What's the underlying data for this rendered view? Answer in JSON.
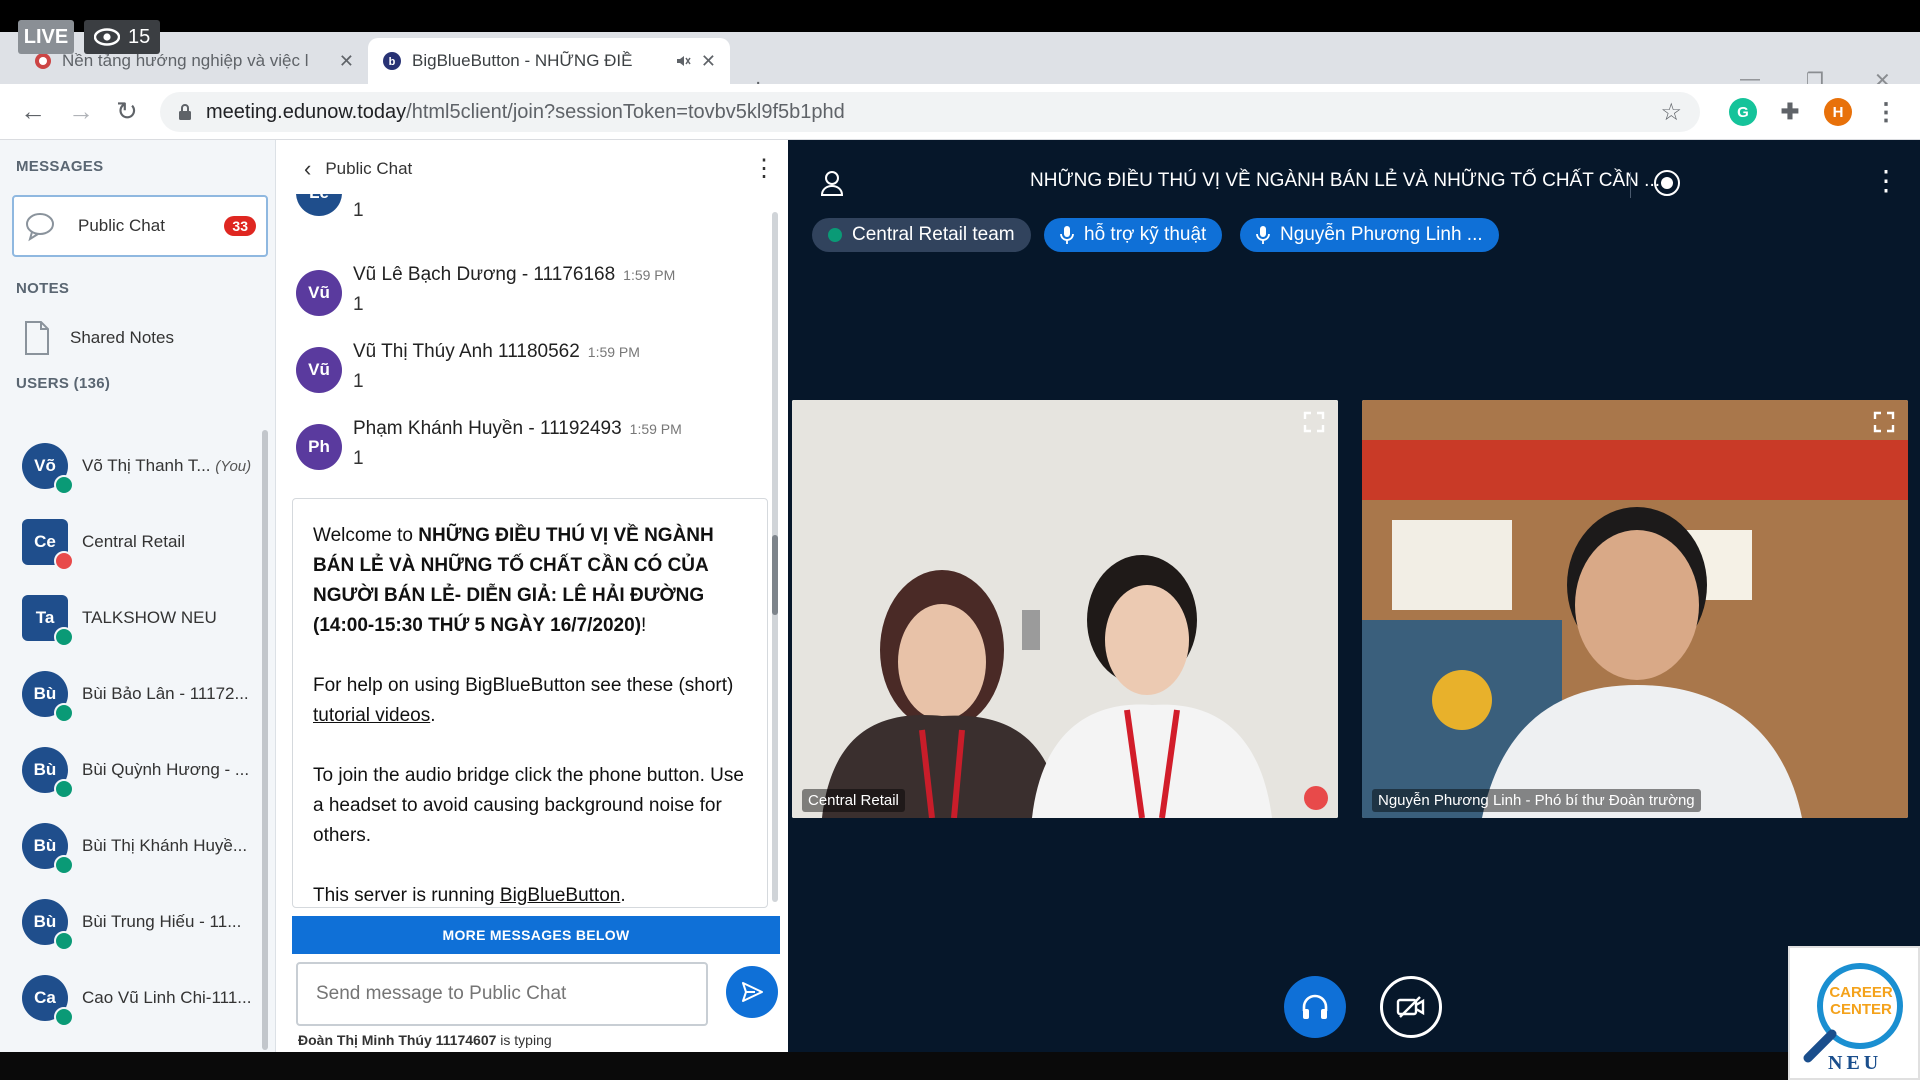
{
  "stream": {
    "live_label": "LIVE",
    "viewer_count": "15"
  },
  "browser": {
    "tabs": [
      {
        "title": "Nền tảng hướng nghiệp và việc l",
        "active": false
      },
      {
        "title": "BigBlueButton - NHỮNG ĐIỀ",
        "active": true
      }
    ],
    "url_host": "meeting.edunow.today",
    "url_path": "/html5client/join?sessionToken=tovbv5kl9f5b1phd",
    "profile_initial": "H"
  },
  "sidebar": {
    "messages_heading": "MESSAGES",
    "public_chat_label": "Public Chat",
    "unread_count": "33",
    "notes_heading": "NOTES",
    "shared_notes_label": "Shared Notes",
    "users_heading": "USERS (136)",
    "users": [
      {
        "initials": "Võ",
        "name": "Võ Thị Thanh T...",
        "you": "(You)",
        "badge": "green",
        "shape": "circle"
      },
      {
        "initials": "Ce",
        "name": "Central Retail",
        "you": "",
        "badge": "red",
        "shape": "square"
      },
      {
        "initials": "Ta",
        "name": "TALKSHOW NEU",
        "you": "",
        "badge": "green",
        "shape": "square"
      },
      {
        "initials": "Bù",
        "name": "Bùi Bảo Lân - 11172...",
        "you": "",
        "badge": "green",
        "shape": "circle"
      },
      {
        "initials": "Bù",
        "name": "Bùi Quỳnh Hương - ...",
        "you": "",
        "badge": "green",
        "shape": "circle"
      },
      {
        "initials": "Bù",
        "name": "Bùi Thị Khánh Huyề...",
        "you": "",
        "badge": "green",
        "shape": "circle"
      },
      {
        "initials": "Bù",
        "name": "Bùi Trung Hiếu - 11...",
        "you": "",
        "badge": "green",
        "shape": "circle"
      },
      {
        "initials": "Ca",
        "name": "Cao Vũ Linh Chi-111...",
        "you": "",
        "badge": "green",
        "shape": "circle"
      }
    ]
  },
  "chat": {
    "title": "Public Chat",
    "partial_avatar": "Lê",
    "partial_text": "1",
    "messages": [
      {
        "initials": "Vũ",
        "name": "Vũ Lê Bạch Dương - 11176168",
        "time": "1:59 PM",
        "text": "1"
      },
      {
        "initials": "Vũ",
        "name": "Vũ Thị Thúy Anh 11180562",
        "time": "1:59 PM",
        "text": "1"
      },
      {
        "initials": "Ph",
        "name": "Phạm Khánh Huyền - 11192493",
        "time": "1:59 PM",
        "text": "1"
      }
    ],
    "welcome": {
      "p1_prefix": "Welcome to ",
      "p1_bold": "NHỮNG ĐIỀU THÚ VỊ VỀ NGÀNH BÁN LẺ VÀ NHỮNG TỐ CHẤT CẦN CÓ CỦA NGƯỜI BÁN LẺ- DIỄN GIẢ: LÊ HẢI ĐƯỜNG (14:00-15:30 THỨ 5 NGÀY 16/7/2020)",
      "p1_suffix": "!",
      "p2_prefix": "For help on using BigBlueButton see these (short) ",
      "p2_link": "tutorial videos",
      "p2_suffix": ".",
      "p3": "To join the audio bridge click the phone button. Use a headset to avoid causing background noise for others.",
      "p4_prefix": "This server is running ",
      "p4_link": "BigBlueButton",
      "p4_suffix": "."
    },
    "more_messages_label": "MORE MESSAGES BELOW",
    "input_placeholder": "Send message to Public Chat",
    "typing_user": "Đoàn Thị Minh Thúy 11174607",
    "typing_suffix": " is typing"
  },
  "meeting": {
    "title": "NHỮNG ĐIỀU THÚ VỊ VỀ NGÀNH BÁN LẺ VÀ NHỮNG TỐ CHẤT CẦN ...",
    "talkers": [
      {
        "label": "Central Retail team",
        "color": "#31435d"
      },
      {
        "label": "hỗ trợ kỹ thuật",
        "color": "#0f70d7"
      },
      {
        "label": "Nguyễn Phương Linh ...",
        "color": "#0f70d7"
      }
    ],
    "videos": [
      {
        "label": "Central Retail"
      },
      {
        "label": "Nguyễn Phương Linh - Phó bí thư Đoàn trường"
      }
    ]
  },
  "watermark": {
    "line1": "CAREER",
    "line2": "CENTER",
    "line3": "NEU"
  },
  "colors": {
    "bbb_blue": "#0f70d7",
    "main_bg": "#06172a",
    "badge_red": "#df2721",
    "status_green": "#0a9a76"
  }
}
